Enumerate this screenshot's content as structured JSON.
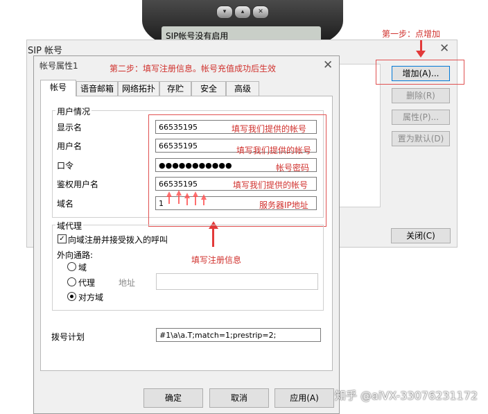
{
  "phone": {
    "screen_text": "SIP帐号没有启用",
    "buttons": [
      "▾",
      "▴",
      "✕"
    ]
  },
  "sip_window": {
    "title": "SIP 帐号",
    "close_glyph": "✕",
    "buttons": {
      "add": "增加(A)...",
      "delete": "删除(R)",
      "properties": "属性(P)...",
      "set_default": "置为默认(D)",
      "close": "关闭(C)"
    }
  },
  "annotations": {
    "step1": "第一步：点增加",
    "step2": "第二步：填写注册信息。帐号充值成功后生效",
    "fill_info": "填写注册信息",
    "display_hint": "填写我们提供的帐号",
    "user_hint": "填写我们提供的帐号",
    "password_hint": "帐号密码",
    "auth_hint": "填写我们提供的帐号",
    "domain_hint": "服务器IP地址"
  },
  "dialog": {
    "title": "帐号属性1",
    "close_glyph": "✕",
    "tabs": [
      "帐号",
      "语音邮箱",
      "网络拓扑",
      "存贮",
      "安全",
      "高级"
    ],
    "user_info": {
      "group_label": "用户情况",
      "display_name_label": "显示名",
      "display_name_value": "66535195",
      "user_name_label": "用户名",
      "user_name_value": "66535195",
      "password_label": "口令",
      "password_value": "●●●●●●●●●●●",
      "auth_user_label": "鉴权用户名",
      "auth_user_value": "66535195",
      "domain_label": "域名",
      "domain_value": "1"
    },
    "proxy": {
      "group_label": "域代理",
      "register_checkbox_label": "向域注册并接受拨入的呼叫",
      "register_checked": "✓",
      "outbound_label": "外向通路:",
      "option_domain": "域",
      "option_proxy": "代理",
      "address_label": "地址",
      "option_target_domain": "对方域"
    },
    "dial_plan_label": "拨号计划",
    "dial_plan_value": "#1\\a\\a.T;match=1;prestrip=2;",
    "buttons": {
      "ok": "确定",
      "cancel": "取消",
      "apply": "应用(A)"
    }
  },
  "watermark": "知乎 @aiVX-33076231172"
}
